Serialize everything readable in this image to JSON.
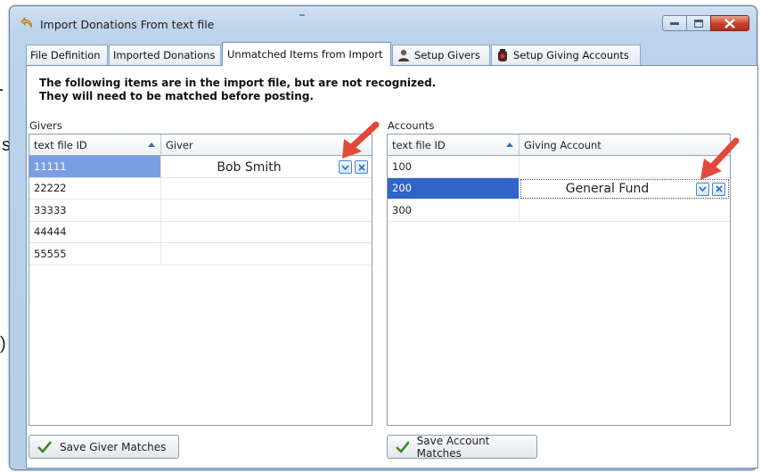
{
  "background_fragments": {
    "s_char": "s.",
    "r_char": ")"
  },
  "window": {
    "title": "Import Donations From text file"
  },
  "tabs": [
    {
      "label": "File Definition"
    },
    {
      "label": "Imported Donations"
    },
    {
      "label": "Unmatched Items from Import"
    },
    {
      "label": "Setup Givers"
    },
    {
      "label": "Setup Giving Accounts"
    }
  ],
  "message": {
    "line1": "The following items are in the import file, but are not recognized.",
    "line2": "They will need to be matched before posting."
  },
  "givers": {
    "group_label": "Givers",
    "columns": [
      "text file ID",
      "Giver"
    ],
    "rows": [
      {
        "id": "11111",
        "giver": "Bob Smith"
      },
      {
        "id": "22222",
        "giver": ""
      },
      {
        "id": "33333",
        "giver": ""
      },
      {
        "id": "44444",
        "giver": ""
      },
      {
        "id": "55555",
        "giver": ""
      }
    ],
    "save_label": "Save Giver Matches"
  },
  "accounts": {
    "group_label": "Accounts",
    "columns": [
      "text file ID",
      "Giving Account"
    ],
    "rows": [
      {
        "id": "100",
        "account": ""
      },
      {
        "id": "200",
        "account": "General Fund"
      },
      {
        "id": "300",
        "account": ""
      }
    ],
    "save_label": "Save Account Matches"
  },
  "colors": {
    "selection_light": "#7b9ee3",
    "selection_dark": "#2f66c8",
    "annotation_arrow": "#e2493a"
  }
}
